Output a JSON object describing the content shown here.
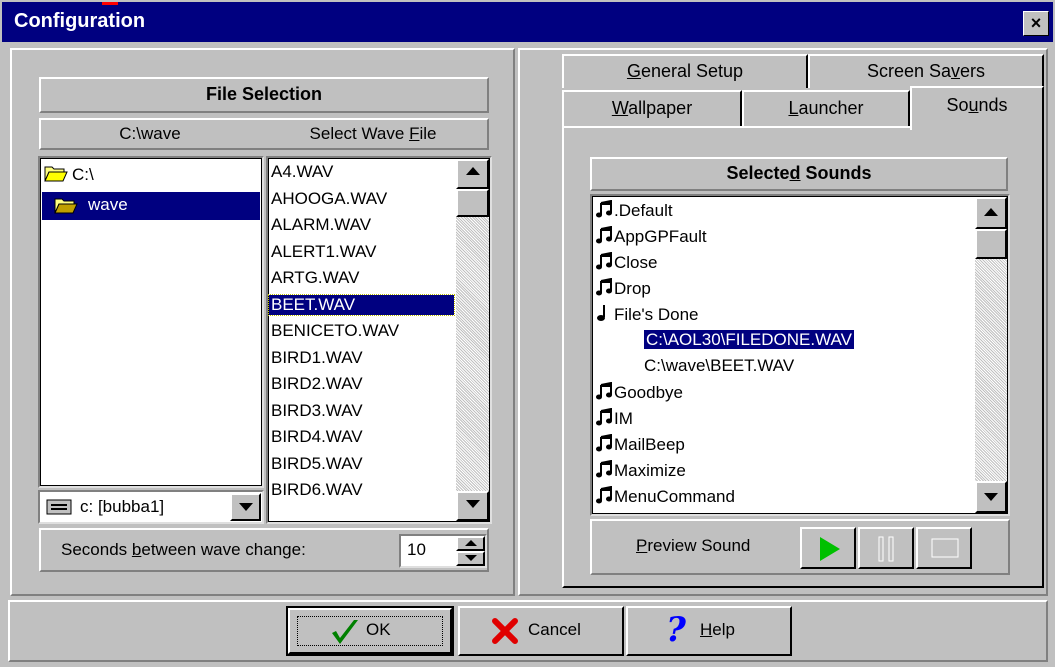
{
  "window": {
    "title": "Configuration",
    "close_label": "×"
  },
  "file_selection": {
    "title": "File Selection",
    "dir_header": "C:\\wave",
    "file_header_prefix": "Select Wave ",
    "file_header_key": "F",
    "file_header_suffix": "ile",
    "folders": [
      {
        "label": "C:\\",
        "selected": false
      },
      {
        "label": "wave",
        "selected": true
      }
    ],
    "files": [
      "A4.WAV",
      "AHOOGA.WAV",
      "ALARM.WAV",
      "ALERT1.WAV",
      "ARTG.WAV",
      "BEET.WAV",
      "BENICETO.WAV",
      "BIRD1.WAV",
      "BIRD2.WAV",
      "BIRD3.WAV",
      "BIRD4.WAV",
      "BIRD5.WAV",
      "BIRD6.WAV"
    ],
    "selected_file": "BEET.WAV",
    "drive": "c: [bubba1]",
    "seconds_label_prefix": "Seconds ",
    "seconds_label_key": "b",
    "seconds_label_suffix": "etween wave change:",
    "seconds_value": "10"
  },
  "transfer": {
    "add_label": ">",
    "remove_label": "<"
  },
  "tabs": {
    "row_back": [
      {
        "key": "G",
        "rest": "eneral Setup"
      },
      {
        "prefix": "Screen Sa",
        "key": "v",
        "rest": "ers"
      }
    ],
    "row_front": [
      {
        "key": "W",
        "rest": "allpaper"
      },
      {
        "key": "L",
        "rest": "auncher"
      },
      {
        "prefix": "So",
        "key": "u",
        "rest": "nds",
        "active": true
      }
    ]
  },
  "sounds": {
    "title_prefix": "Selecte",
    "title_key": "d",
    "title_suffix": " Sounds",
    "items": [
      {
        "label": ".Default",
        "icon": "music-note-double",
        "indent": 0
      },
      {
        "label": "AppGPFault",
        "icon": "music-note-double",
        "indent": 0
      },
      {
        "label": "Close",
        "icon": "music-note-double",
        "indent": 0
      },
      {
        "label": "Drop",
        "icon": "music-note-double",
        "indent": 0
      },
      {
        "label": "File's Done",
        "icon": "music-note-single",
        "indent": 0
      },
      {
        "label": "C:\\AOL30\\FILEDONE.WAV",
        "icon": "",
        "indent": 1,
        "selected": true
      },
      {
        "label": "C:\\wave\\BEET.WAV",
        "icon": "",
        "indent": 1
      },
      {
        "label": "Goodbye",
        "icon": "music-note-double",
        "indent": 0
      },
      {
        "label": "IM",
        "icon": "music-note-double",
        "indent": 0
      },
      {
        "label": "MailBeep",
        "icon": "music-note-double",
        "indent": 0
      },
      {
        "label": "Maximize",
        "icon": "music-note-double",
        "indent": 0
      },
      {
        "label": "MenuCommand",
        "icon": "music-note-double",
        "indent": 0
      }
    ],
    "preview_key": "P",
    "preview_rest": "review Sound"
  },
  "buttons": {
    "ok": "OK",
    "cancel": "Cancel",
    "help_key": "H",
    "help_rest": "elp"
  },
  "colors": {
    "title_bg": "#000080",
    "face": "#c0c0c0",
    "selection": "#000080",
    "play_green": "#00c000",
    "cancel_red": "#e00000",
    "help_blue": "#0000ff",
    "ok_green": "#008000"
  }
}
